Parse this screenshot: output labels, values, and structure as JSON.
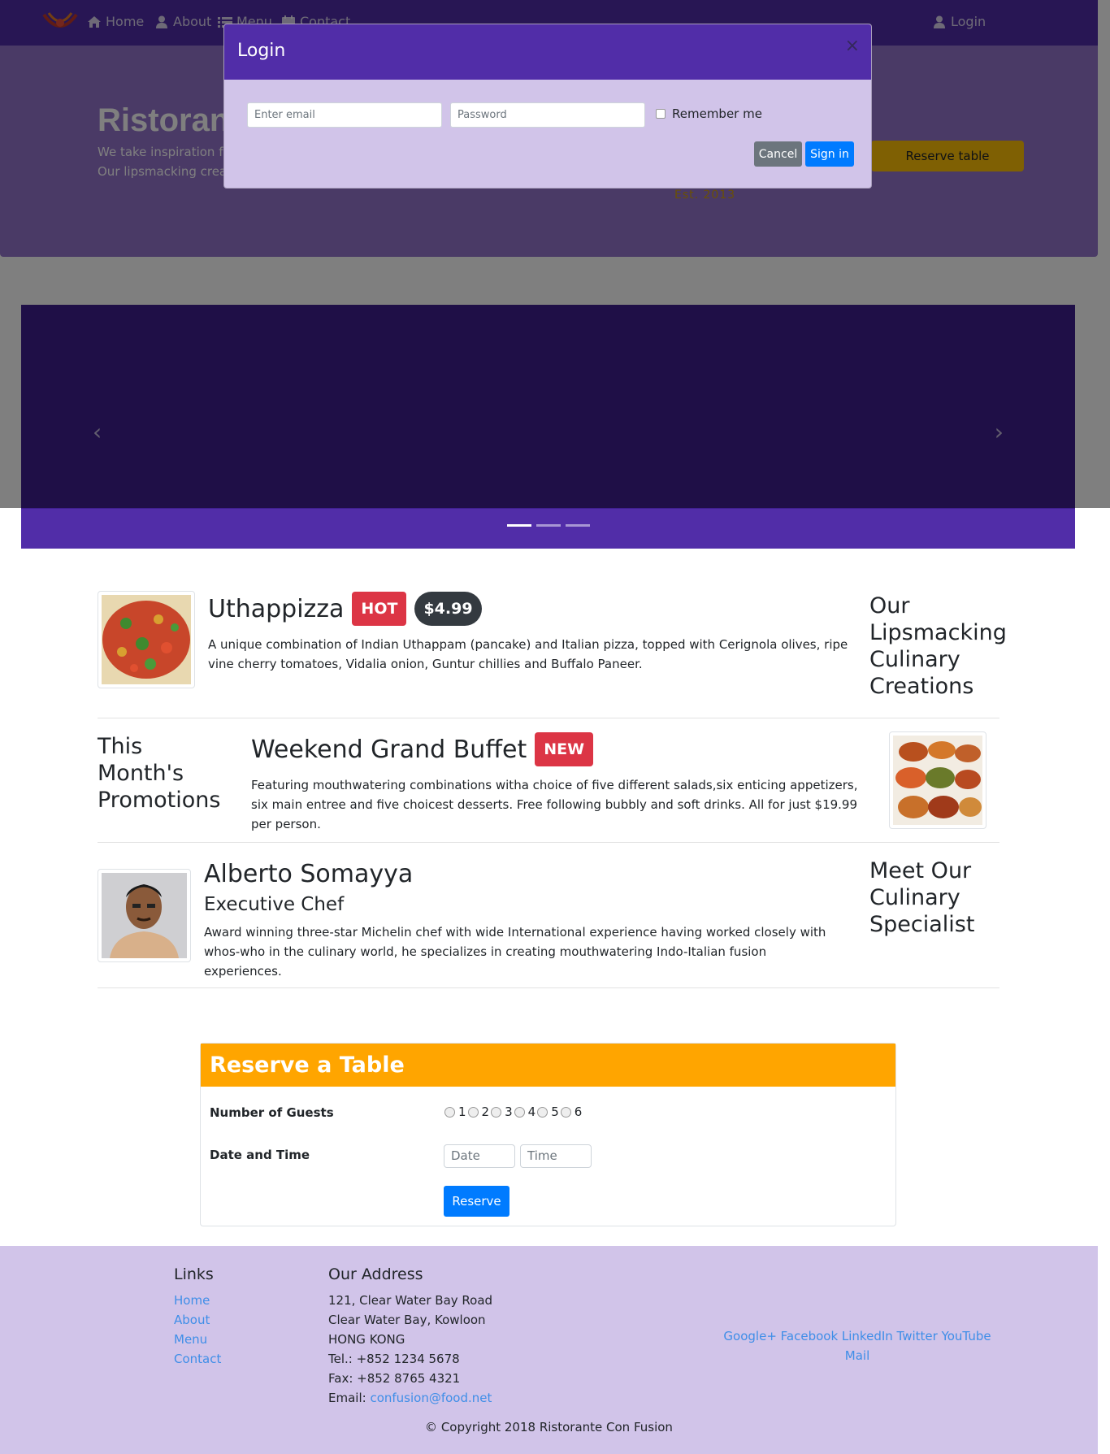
{
  "navbar": {
    "links": [
      {
        "label": "Home",
        "icon": "home-icon"
      },
      {
        "label": "About",
        "icon": "user-icon"
      },
      {
        "label": "Menu",
        "icon": "list-icon"
      },
      {
        "label": "Contact",
        "icon": "address-card-icon"
      }
    ],
    "login_label": "Login"
  },
  "jumbotron": {
    "title": "Ristorante con Fusion",
    "line1": "We take inspiration from the World's best cuisines, and create a unique fusion experience.",
    "line2": "Our lipsmacking creations will tickle your culinary senses!",
    "logo_text": "Est. 2013",
    "reserve_label": "Reserve table"
  },
  "modal": {
    "title": "Login",
    "email_placeholder": "Enter email",
    "password_placeholder": "Password",
    "remember_label": "Remember me",
    "cancel_label": "Cancel",
    "signin_label": "Sign in"
  },
  "carousel": {
    "prev_icon": "chevron-left-icon",
    "next_icon": "chevron-right-icon",
    "indicator_count": 3
  },
  "items": [
    {
      "title": "Uthappizza",
      "badge": "HOT",
      "price": "$4.99",
      "text": "A unique combination of Indian Uthappam (pancake) and Italian pizza, topped with Cerignola olives, ripe vine cherry tomatoes, Vidalia onion, Guntur chillies and Buffalo Paneer.",
      "side_heading": [
        "Our",
        "Lipsmacking",
        "Culinary",
        "Creations"
      ]
    },
    {
      "title": "Weekend Grand Buffet",
      "badge": "NEW",
      "text": "Featuring mouthwatering combinations witha choice of five different salads,six enticing appetizers, six main entree and five choicest desserts. Free following bubbly and soft drinks. All for just $19.99 per person.",
      "side_heading": [
        "This",
        "Month's",
        "Promotions"
      ]
    },
    {
      "title": "Alberto Somayya",
      "subtitle": "Executive Chef",
      "text": "Award winning three-star Michelin chef with wide International experience having worked closely with whos-who in the culinary world, he specializes in creating mouthwatering Indo-Italian fusion experiences.",
      "side_heading": [
        "Meet Our",
        "Culinary",
        "Specialist"
      ]
    }
  ],
  "reserve": {
    "title": "Reserve a Table",
    "guests_label": "Number of Guests",
    "guest_options": [
      "1",
      "2",
      "3",
      "4",
      "5",
      "6"
    ],
    "datetime_label": "Date and Time",
    "date_placeholder": "Date",
    "time_placeholder": "Time",
    "button_label": "Reserve"
  },
  "footer": {
    "links_heading": "Links",
    "links": [
      "Home",
      "About",
      "Menu",
      "Contact"
    ],
    "address_heading": "Our Address",
    "address_lines": [
      "121, Clear Water Bay Road",
      "Clear Water Bay, Kowloon",
      "HONG KONG",
      "Tel.: +852 1234 5678",
      "Fax: +852 8765 4321"
    ],
    "email_prefix": "Email:",
    "email": "confusion@food.net",
    "social_line1": "Google+ Facebook LinkedIn Twitter YouTube",
    "social_line2": "Mail",
    "copyright": "© Copyright 2018 Ristorante Con Fusion"
  }
}
